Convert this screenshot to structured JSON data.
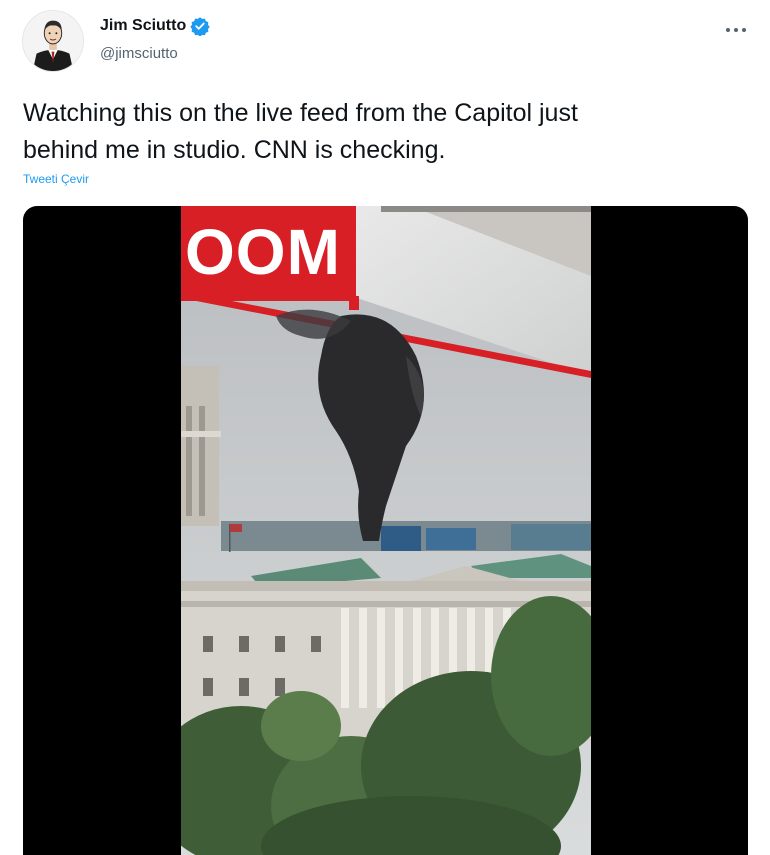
{
  "author": {
    "display_name": "Jim Sciutto",
    "handle": "@jimsciutto",
    "verified": true,
    "avatar_icon": "avatar-illustration-icon"
  },
  "menu": {
    "icon": "more-horizontal-icon"
  },
  "tweet": {
    "text": "Watching this on the live feed from the Capitol just\nbehind me in studio. CNN is checking.",
    "translate_label": "Tweeti Çevir"
  },
  "media": {
    "type": "video-still",
    "overlay_text": "OOM"
  },
  "colors": {
    "verified_blue": "#1d9bf0",
    "link_blue": "#1d9bf0",
    "broadcast_red": "#d81f26",
    "secondary_text": "#536471"
  }
}
